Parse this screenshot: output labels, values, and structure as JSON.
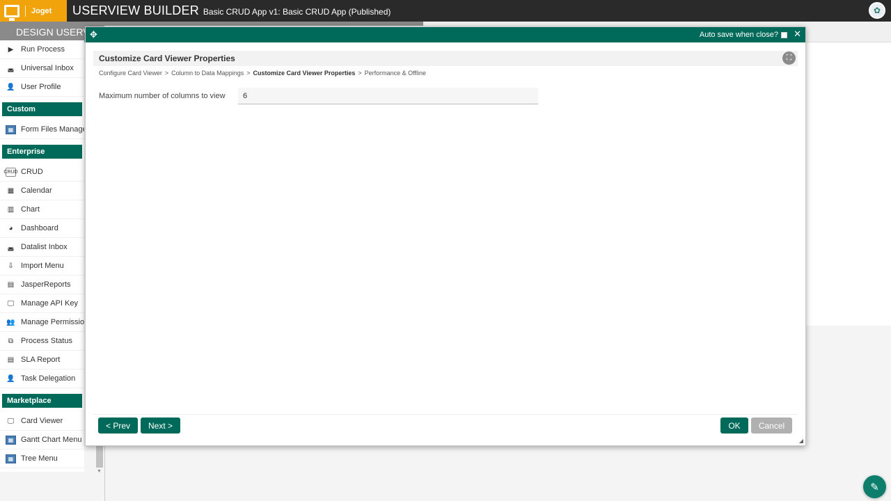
{
  "topbar": {
    "logo_text": "Joget",
    "builder_title": "USERVIEW BUILDER",
    "app_title": "Basic CRUD App v1: Basic CRUD App (Published)"
  },
  "subbar": {
    "design_tab": "DESIGN USERVIEW"
  },
  "sidebar": {
    "items_top": [
      {
        "label": "Run Process",
        "icon": "play-icon"
      },
      {
        "label": "Universal Inbox",
        "icon": "inbox-icon"
      },
      {
        "label": "User Profile",
        "icon": "user-edit-icon"
      }
    ],
    "custom_head": "Custom",
    "items_custom": [
      {
        "label": "Form Files Manager",
        "icon": "form-icon"
      }
    ],
    "enterprise_head": "Enterprise",
    "items_enterprise": [
      {
        "label": "CRUD",
        "icon": "crud-icon",
        "icon_text": "CRUD"
      },
      {
        "label": "Calendar",
        "icon": "calendar-icon"
      },
      {
        "label": "Chart",
        "icon": "chart-icon"
      },
      {
        "label": "Dashboard",
        "icon": "dashboard-icon"
      },
      {
        "label": "Datalist Inbox",
        "icon": "inbox-icon"
      },
      {
        "label": "Import Menu",
        "icon": "import-icon"
      },
      {
        "label": "JasperReports",
        "icon": "report-icon"
      },
      {
        "label": "Manage API Key",
        "icon": "monitor-icon"
      },
      {
        "label": "Manage Permission",
        "icon": "users-icon"
      },
      {
        "label": "Process Status",
        "icon": "process-icon"
      },
      {
        "label": "SLA Report",
        "icon": "list-icon"
      },
      {
        "label": "Task Delegation",
        "icon": "user-delegate-icon"
      }
    ],
    "marketplace_head": "Marketplace",
    "items_marketplace": [
      {
        "label": "Card Viewer",
        "icon": "monitor-icon"
      },
      {
        "label": "Gantt Chart Menu",
        "icon": "gantt-icon"
      },
      {
        "label": "Tree Menu",
        "icon": "tree-icon"
      }
    ]
  },
  "dialog": {
    "autosave_label": "Auto save when close?",
    "autosave_checked": false,
    "title": "Customize Card Viewer Properties",
    "breadcrumb": [
      {
        "label": "Configure Card Viewer",
        "current": false
      },
      {
        "label": "Column to Data Mappings",
        "current": false
      },
      {
        "label": "Customize Card Viewer Properties",
        "current": true
      },
      {
        "label": "Performance & Offline",
        "current": false
      }
    ],
    "breadcrumb_sep": ">",
    "field_label": "Maximum number of columns to view",
    "field_value": "6",
    "prev_label": "< Prev",
    "next_label": "Next >",
    "ok_label": "OK",
    "cancel_label": "Cancel"
  },
  "colors": {
    "brand_green": "#006a5a",
    "logo_orange": "#f0a30a",
    "topbar_dark": "#2a2a2a"
  }
}
